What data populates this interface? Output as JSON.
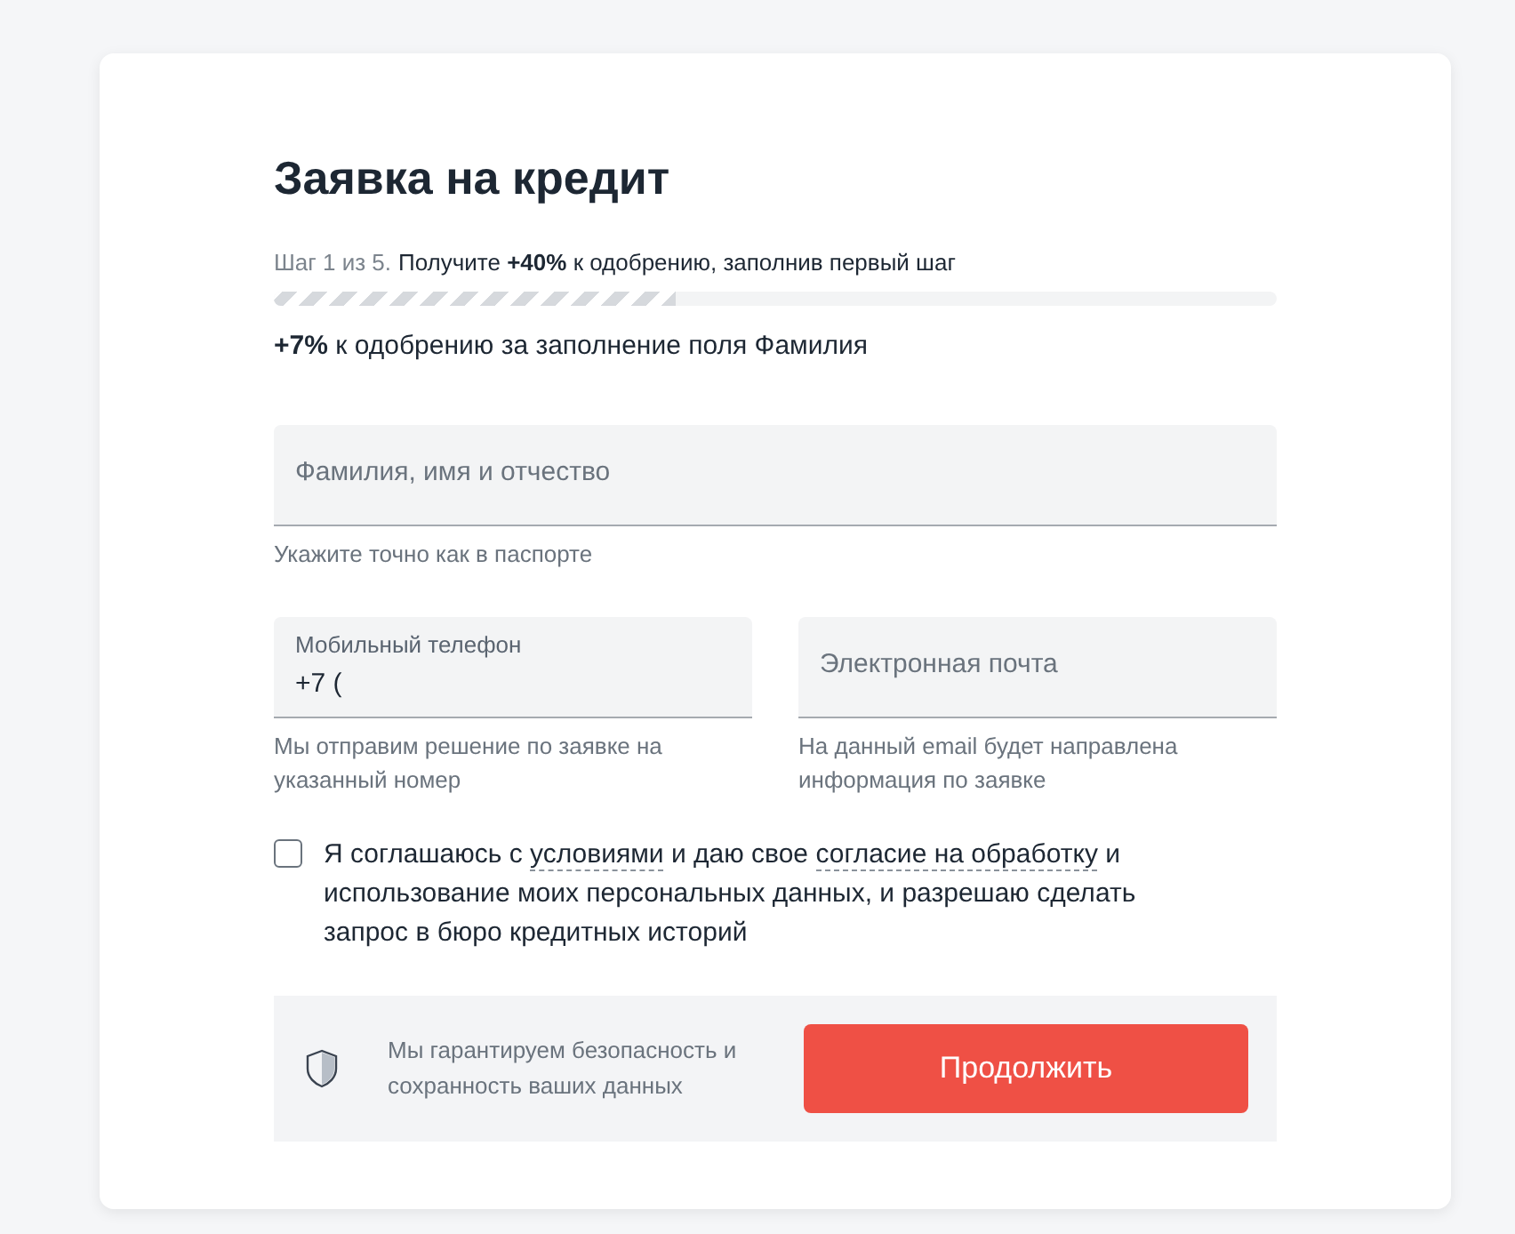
{
  "title": "Заявка на кредит",
  "progress": {
    "step": "Шаг 1 из 5.",
    "promo": "Получите **+40%** к одобрению, заполнив первый шаг",
    "level": 0.4
  },
  "bonus": "**+7%** к одобрению за заполнение поля Фамилия",
  "fields": [
    {
      "label": "Фамилия, имя и отчество",
      "hint": "Укажите точно как в паспорте"
    },
    {
      "label": "Мобильный телефон",
      "value": "+7 (",
      "hint": "Мы отправим решение по заявке на указанный номер"
    },
    {
      "label": "Электронная почта",
      "hint": "На данный email будет направлена информация по заявке"
    }
  ],
  "consent": {
    "checked": false,
    "parts": [
      {
        "kind": "text",
        "text": "Я соглашаюсь с "
      },
      {
        "kind": "link",
        "text": "условиями"
      },
      {
        "kind": "text",
        "text": " и даю свое "
      },
      {
        "kind": "link",
        "text": "согласие на обработку"
      },
      {
        "kind": "text",
        "text": " и использование моих персональных данных, и разрешаю сделать запрос в бюро кредитных историй"
      }
    ]
  },
  "security": "Мы гарантируем безопасность и сохранность ваших данных",
  "submit": "Продолжить"
}
